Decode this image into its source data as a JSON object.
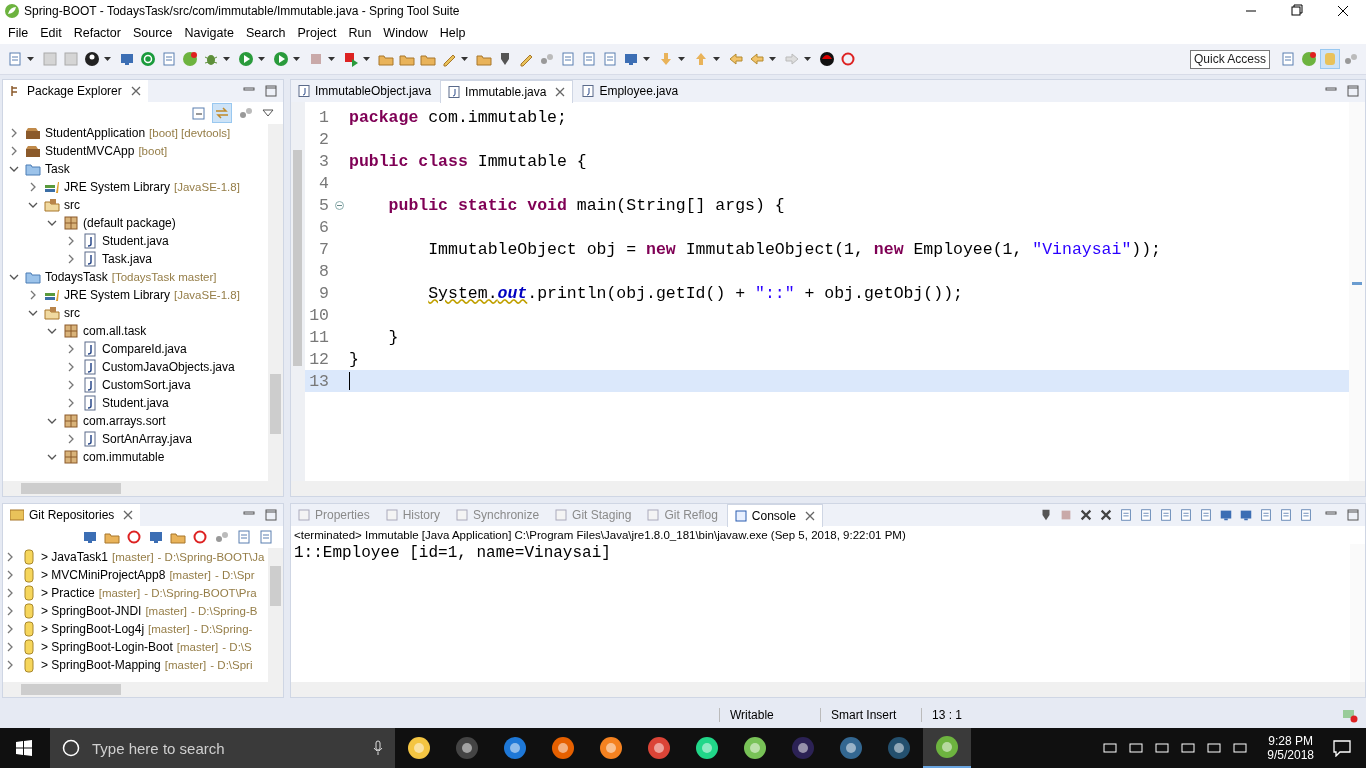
{
  "window": {
    "title": "Spring-BOOT - TodaysTask/src/com/immutable/Immutable.java - Spring Tool Suite"
  },
  "menu": [
    "File",
    "Edit",
    "Refactor",
    "Source",
    "Navigate",
    "Search",
    "Project",
    "Run",
    "Window",
    "Help"
  ],
  "quick_access": {
    "placeholder": "Quick Access"
  },
  "explorer": {
    "title": "Package Explorer",
    "items": [
      {
        "label": "StudentApplication",
        "decoration": "[boot] [devtools]",
        "kind": "boot-project",
        "expanded": false
      },
      {
        "label": "StudentMVCApp",
        "decoration": "[boot]",
        "kind": "boot-project",
        "expanded": false
      },
      {
        "label": "Task",
        "kind": "project",
        "expanded": true,
        "children": [
          {
            "label": "JRE System Library",
            "decoration": "[JavaSE-1.8]",
            "kind": "library",
            "expanded": false
          },
          {
            "label": "src",
            "kind": "source-folder",
            "expanded": true,
            "children": [
              {
                "label": "(default package)",
                "kind": "package",
                "expanded": true,
                "children": [
                  {
                    "label": "Student.java",
                    "kind": "java-file",
                    "expanded": false
                  },
                  {
                    "label": "Task.java",
                    "kind": "java-file",
                    "expanded": false
                  }
                ]
              }
            ]
          }
        ]
      },
      {
        "label": "TodaysTask",
        "decoration": "[TodaysTask master]",
        "kind": "project",
        "expanded": true,
        "children": [
          {
            "label": "JRE System Library",
            "decoration": "[JavaSE-1.8]",
            "kind": "library",
            "expanded": false
          },
          {
            "label": "src",
            "kind": "source-folder",
            "expanded": true,
            "children": [
              {
                "label": "com.all.task",
                "kind": "package",
                "expanded": true,
                "children": [
                  {
                    "label": "CompareId.java",
                    "kind": "java-file",
                    "expanded": false
                  },
                  {
                    "label": "CustomJavaObjects.java",
                    "kind": "java-file",
                    "expanded": false
                  },
                  {
                    "label": "CustomSort.java",
                    "kind": "java-file",
                    "expanded": false
                  },
                  {
                    "label": "Student.java",
                    "kind": "java-file",
                    "expanded": false
                  }
                ]
              },
              {
                "label": "com.arrays.sort",
                "kind": "package",
                "expanded": true,
                "children": [
                  {
                    "label": "SortAnArray.java",
                    "kind": "java-file",
                    "expanded": false
                  }
                ]
              },
              {
                "label": "com.immutable",
                "kind": "package",
                "expanded": true
              }
            ]
          }
        ]
      }
    ]
  },
  "git": {
    "title": "Git Repositories",
    "repos": [
      {
        "name": "> JavaTask1",
        "branch": "[master]",
        "path": "- D:\\Spring-BOOT\\Ja"
      },
      {
        "name": "> MVCMiniProjectApp8",
        "branch": "[master]",
        "path": "- D:\\Spr"
      },
      {
        "name": "> Practice",
        "branch": "[master]",
        "path": "- D:\\Spring-BOOT\\Pra"
      },
      {
        "name": "> SpringBoot-JNDI",
        "branch": "[master]",
        "path": "- D:\\Spring-B"
      },
      {
        "name": "> SpringBoot-Log4j",
        "branch": "[master]",
        "path": "- D:\\Spring-"
      },
      {
        "name": "> SpringBoot-Login-Boot",
        "branch": "[master]",
        "path": "- D:\\S"
      },
      {
        "name": "> SpringBoot-Mapping",
        "branch": "[master]",
        "path": "- D:\\Spri"
      }
    ]
  },
  "editor": {
    "tabs": [
      {
        "label": "ImmutableObject.java",
        "selected": false
      },
      {
        "label": "Immutable.java",
        "selected": true
      },
      {
        "label": "Employee.java",
        "selected": false
      }
    ],
    "lines": [
      {
        "number": "1",
        "fold": false,
        "current": false,
        "tokens": [
          {
            "t": "package",
            "kind": "kw"
          },
          {
            "t": " com.immutable;",
            "kind": "plain"
          }
        ]
      },
      {
        "number": "2",
        "fold": false,
        "current": false
      },
      {
        "number": "3",
        "fold": false,
        "current": false,
        "tokens": [
          {
            "t": "public ",
            "kind": "kw"
          },
          {
            "t": "class",
            "kind": "kw"
          },
          {
            "t": " Immutable {",
            "kind": "plain"
          }
        ]
      },
      {
        "number": "4",
        "fold": false,
        "current": false
      },
      {
        "number": "5",
        "fold": true,
        "current": false,
        "tokens": [
          {
            "t": "    public ",
            "kind": "kw"
          },
          {
            "t": "static ",
            "kind": "kw"
          },
          {
            "t": "void",
            "kind": "kw"
          },
          {
            "t": " main(String[] args) {",
            "kind": "plain"
          }
        ]
      },
      {
        "number": "6",
        "fold": false,
        "current": false
      },
      {
        "number": "7",
        "fold": false,
        "current": false,
        "tokens": [
          {
            "t": "        ImmutableObject obj = ",
            "kind": "plain"
          },
          {
            "t": "new",
            "kind": "kw"
          },
          {
            "t": " ImmutableObject(1, ",
            "kind": "plain"
          },
          {
            "t": "new",
            "kind": "kw"
          },
          {
            "t": " Employee(1, ",
            "kind": "plain"
          },
          {
            "t": "\"Vinaysai\"",
            "kind": "str"
          },
          {
            "t": "));",
            "kind": "plain"
          }
        ]
      },
      {
        "number": "8",
        "fold": false,
        "current": false
      },
      {
        "number": "9",
        "fold": false,
        "current": false,
        "tokens": [
          {
            "t": "        System.",
            "kind": "warn"
          },
          {
            "t": "out",
            "kind": "field"
          },
          {
            "t": ".println(obj.getId() + ",
            "kind": "plain"
          },
          {
            "t": "\"::\"",
            "kind": "str"
          },
          {
            "t": " + obj.getObj());",
            "kind": "plain"
          }
        ]
      },
      {
        "number": "10",
        "fold": false,
        "current": false
      },
      {
        "number": "11",
        "fold": false,
        "current": false,
        "tokens": [
          {
            "t": "    }",
            "kind": "plain"
          }
        ]
      },
      {
        "number": "12",
        "fold": false,
        "current": false,
        "tokens": [
          {
            "t": "}",
            "kind": "plain"
          }
        ]
      },
      {
        "number": "13",
        "fold": false,
        "current": true
      }
    ]
  },
  "console": {
    "tabs": [
      {
        "label": "Properties",
        "selected": false
      },
      {
        "label": "History",
        "selected": false
      },
      {
        "label": "Synchronize",
        "selected": false
      },
      {
        "label": "Git Staging",
        "selected": false
      },
      {
        "label": "Git Reflog",
        "selected": false
      },
      {
        "label": "Console",
        "selected": true
      }
    ],
    "header": "<terminated> Immutable [Java Application] C:\\Program Files\\Java\\jre1.8.0_181\\bin\\javaw.exe (Sep 5, 2018, 9:22:01 PM)",
    "output": "1::Employee [id=1, name=Vinaysai]"
  },
  "status_bar": [
    "Writable",
    "Smart Insert",
    "13 : 1"
  ],
  "taskbar": {
    "search": {
      "placeholder": "Type here to search"
    },
    "time": "9:28 PM",
    "date": "9/5/2018"
  }
}
